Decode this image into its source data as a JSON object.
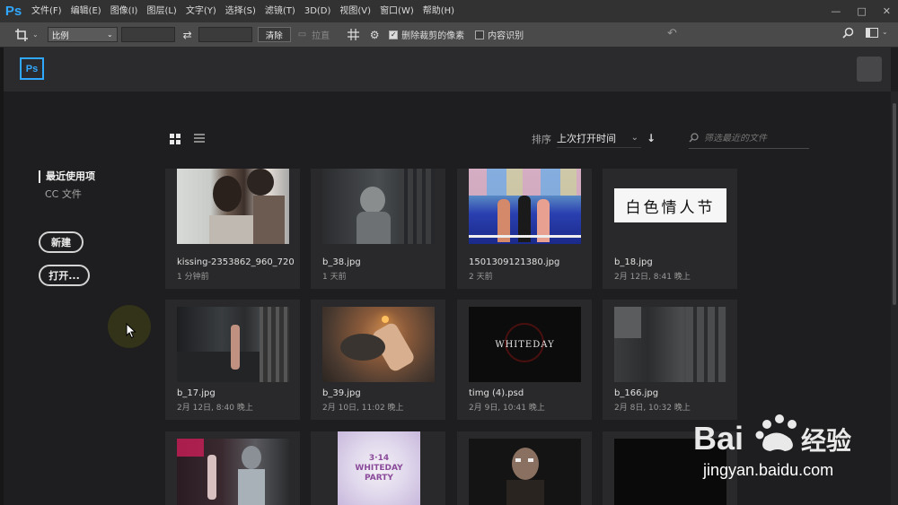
{
  "app": {
    "logo": "Ps"
  },
  "menu": [
    "文件(F)",
    "编辑(E)",
    "图像(I)",
    "图层(L)",
    "文字(Y)",
    "选择(S)",
    "滤镜(T)",
    "3D(D)",
    "视图(V)",
    "窗口(W)",
    "帮助(H)"
  ],
  "window_controls": {
    "minimize": "—",
    "maximize": "□",
    "close": "✕"
  },
  "options_bar": {
    "crop_icon": "crop-icon",
    "ratio_select": "比例",
    "swap_icon": "⇄",
    "clear_button": "清除",
    "straighten_label": "拉直",
    "delete_cropped_label": "删除裁剪的像素",
    "delete_cropped_checked": true,
    "content_aware_label": "内容识别",
    "content_aware_checked": false
  },
  "start": {
    "logo": "Ps"
  },
  "sidebar": {
    "recent": "最近使用项",
    "cc_files": "CC 文件",
    "new_button": "新建",
    "open_button": "打开..."
  },
  "toolbar": {
    "sort_label": "排序",
    "sort_value": "上次打开时间",
    "filter_placeholder": "筛选最近的文件"
  },
  "files": [
    {
      "name": "kissing-2353862_960_720...",
      "date": "1 分钟前"
    },
    {
      "name": "b_38.jpg",
      "date": "1 天前"
    },
    {
      "name": "1501309121380.jpg",
      "date": "2 天前"
    },
    {
      "name": "b_18.jpg",
      "date": "2月 12日, 8:41 晚上",
      "thumb_text": "白色情人节"
    },
    {
      "name": "b_17.jpg",
      "date": "2月 12日, 8:40 晚上"
    },
    {
      "name": "b_39.jpg",
      "date": "2月 10日, 11:02 晚上"
    },
    {
      "name": "timg (4).psd",
      "date": "2月 9日, 10:41 晚上",
      "thumb_text": "WHITEDAY"
    },
    {
      "name": "b_166.jpg",
      "date": "2月 8日, 10:32 晚上"
    },
    {
      "name": "",
      "date": ""
    },
    {
      "name": "",
      "date": "",
      "thumb_text": "3·14 WHITEDAY PARTY"
    },
    {
      "name": "",
      "date": ""
    },
    {
      "name": "",
      "date": ""
    }
  ],
  "watermark": {
    "text": "jingyan.baidu.com",
    "logo": "Bai 经验"
  }
}
